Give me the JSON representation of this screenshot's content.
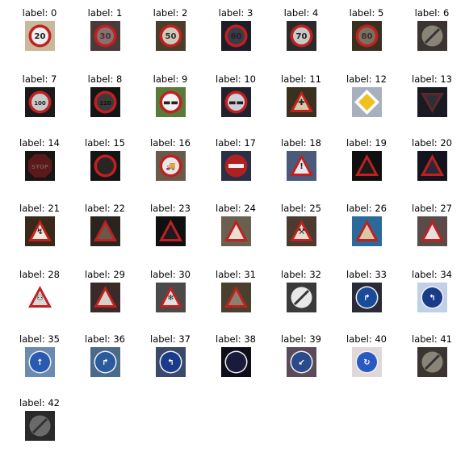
{
  "labels": [
    "label: 0",
    "label: 1",
    "label: 2",
    "label: 3",
    "label: 4",
    "label: 5",
    "label: 6",
    "label: 7",
    "label: 8",
    "label: 9",
    "label: 10",
    "label: 11",
    "label: 12",
    "label: 13",
    "label: 14",
    "label: 15",
    "label: 16",
    "label: 17",
    "label: 18",
    "label: 19",
    "label: 20",
    "label: 21",
    "label: 22",
    "label: 23",
    "label: 24",
    "label: 25",
    "label: 26",
    "label: 27",
    "label: 28",
    "label: 29",
    "label: 30",
    "label: 31",
    "label: 32",
    "label: 33",
    "label: 34",
    "label: 35",
    "label: 36",
    "label: 37",
    "label: 38",
    "label: 39",
    "label: 40",
    "label: 41",
    "label: 42"
  ],
  "signs": [
    {
      "kind": "round-red",
      "bg": "#c9b99a",
      "face": "#eeeeee",
      "text": "20",
      "tcol": "#222222"
    },
    {
      "kind": "round-red",
      "bg": "#4a3a3a",
      "face": "#8a7070",
      "text": "30",
      "tcol": "#443333"
    },
    {
      "kind": "round-red",
      "bg": "#4a3d2a",
      "face": "#d0c8b8",
      "text": "50",
      "tcol": "#333333"
    },
    {
      "kind": "round-red",
      "bg": "#1e1e2a",
      "face": "#3a3a48",
      "text": "60",
      "tcol": "#22222a"
    },
    {
      "kind": "round-red",
      "bg": "#2a2a2a",
      "face": "#c8c8c8",
      "text": "70",
      "tcol": "#222222"
    },
    {
      "kind": "round-red",
      "bg": "#3a3020",
      "face": "#7a7060",
      "text": "80",
      "tcol": "#333333"
    },
    {
      "kind": "end-speed",
      "bg": "#3a3530",
      "face": "#8a8478",
      "text": "",
      "tcol": "#333333"
    },
    {
      "kind": "round-red",
      "bg": "#1a1a1a",
      "face": "#c8c8c8",
      "text": "100",
      "tcol": "#222222"
    },
    {
      "kind": "round-red",
      "bg": "#151515",
      "face": "#3a3a3a",
      "text": "120",
      "tcol": "#111111"
    },
    {
      "kind": "round-red",
      "bg": "#5a7a3a",
      "face": "#f2f2f2",
      "text": "▬▬",
      "tcol": "#222222"
    },
    {
      "kind": "round-red",
      "bg": "#22222e",
      "face": "#cfcfd8",
      "text": "▬▬",
      "tcol": "#222222"
    },
    {
      "kind": "triangle",
      "bg": "#3a3020",
      "face": "#d8c8a8",
      "text": "✚",
      "tcol": "#222222"
    },
    {
      "kind": "diamond",
      "bg": "#a8b0c0",
      "face": "#f0c020",
      "text": "",
      "tcol": "#ffffff"
    },
    {
      "kind": "inv-triangle",
      "bg": "#1a1a22",
      "face": "#2e2e38",
      "text": "",
      "tcol": "#ffffff"
    },
    {
      "kind": "octagon",
      "bg": "#1a1515",
      "face": "#5a1a1a",
      "text": "STOP",
      "tcol": "#7a5050"
    },
    {
      "kind": "round-red",
      "bg": "#151515",
      "face": "#2a2525",
      "text": "",
      "tcol": "#111111"
    },
    {
      "kind": "round-red",
      "bg": "#6a5a4a",
      "face": "#e8e8e8",
      "text": "🚚",
      "tcol": "#222222"
    },
    {
      "kind": "no-entry",
      "bg": "#2a3048",
      "face": "#b02020",
      "text": "",
      "tcol": "#ffffff"
    },
    {
      "kind": "triangle",
      "bg": "#4a5a7a",
      "face": "#e8e8ec",
      "text": "!",
      "tcol": "#222222"
    },
    {
      "kind": "triangle",
      "bg": "#101010",
      "face": "#1a1a1a",
      "text": "",
      "tcol": "#222222"
    },
    {
      "kind": "triangle",
      "bg": "#14141e",
      "face": "#2a2a36",
      "text": "",
      "tcol": "#1a1a22"
    },
    {
      "kind": "triangle",
      "bg": "#3a2818",
      "face": "#f0e8d8",
      "text": "↯",
      "tcol": "#222222"
    },
    {
      "kind": "triangle",
      "bg": "#2a2420",
      "face": "#6a5a4a",
      "text": "",
      "tcol": "#2a2420"
    },
    {
      "kind": "triangle",
      "bg": "#101012",
      "face": "#1c1c20",
      "text": "",
      "tcol": "#101012"
    },
    {
      "kind": "triangle",
      "bg": "#6a6050",
      "face": "#e8e0d0",
      "text": "",
      "tcol": "#222222"
    },
    {
      "kind": "triangle",
      "bg": "#4a3a30",
      "face": "#e8dcd0",
      "text": "⚒",
      "tcol": "#222222"
    },
    {
      "kind": "triangle",
      "bg": "#2a6a9a",
      "face": "#d8c8a8",
      "text": "",
      "tcol": "#222222"
    },
    {
      "kind": "triangle",
      "bg": "#5a4a4a",
      "face": "#e8e0e0",
      "text": "",
      "tcol": "#222222"
    },
    {
      "kind": "triangle",
      "bg": "#ffffff",
      "face": "#d8d8d8",
      "text": "⚇",
      "tcol": "#222222"
    },
    {
      "kind": "triangle",
      "bg": "#3a2a2a",
      "face": "#d8d0c8",
      "text": "",
      "tcol": "#222222"
    },
    {
      "kind": "triangle",
      "bg": "#4a4a4a",
      "face": "#e0e0e0",
      "text": "❄",
      "tcol": "#222222"
    },
    {
      "kind": "triangle",
      "bg": "#4a4030",
      "face": "#8a8070",
      "text": "",
      "tcol": "#333333"
    },
    {
      "kind": "end-speed",
      "bg": "#3a3a3a",
      "face": "#e8e8e8",
      "text": "",
      "tcol": "#333333"
    },
    {
      "kind": "round-blue",
      "bg": "#2a2a3a",
      "face": "#1a4a9a",
      "text": "↱",
      "tcol": "#ffffff"
    },
    {
      "kind": "round-blue",
      "bg": "#c0d0e8",
      "face": "#1a3a8a",
      "text": "↰",
      "tcol": "#ffffff"
    },
    {
      "kind": "round-blue",
      "bg": "#6a8ab0",
      "face": "#2a5ab0",
      "text": "↑",
      "tcol": "#ffffff"
    },
    {
      "kind": "round-blue",
      "bg": "#4a6a8a",
      "face": "#2a5aa0",
      "text": "↱",
      "tcol": "#ffffff"
    },
    {
      "kind": "round-blue",
      "bg": "#3a4a6a",
      "face": "#1a3a8a",
      "text": "↰",
      "tcol": "#ffffff"
    },
    {
      "kind": "round-blue",
      "bg": "#0e0e1a",
      "face": "#1a1a3a",
      "text": "",
      "tcol": "#1a1a2a"
    },
    {
      "kind": "round-blue",
      "bg": "#5a4a5a",
      "face": "#2a4a8a",
      "text": "↙",
      "tcol": "#ffffff"
    },
    {
      "kind": "round-blue",
      "bg": "#e0d8d8",
      "face": "#2a5ac0",
      "text": "↻",
      "tcol": "#ffffff"
    },
    {
      "kind": "end-speed",
      "bg": "#3a3530",
      "face": "#8a8478",
      "text": "",
      "tcol": "#333333"
    },
    {
      "kind": "end-speed",
      "bg": "#2a2a2a",
      "face": "#6a6a6a",
      "text": "",
      "tcol": "#333333"
    }
  ]
}
